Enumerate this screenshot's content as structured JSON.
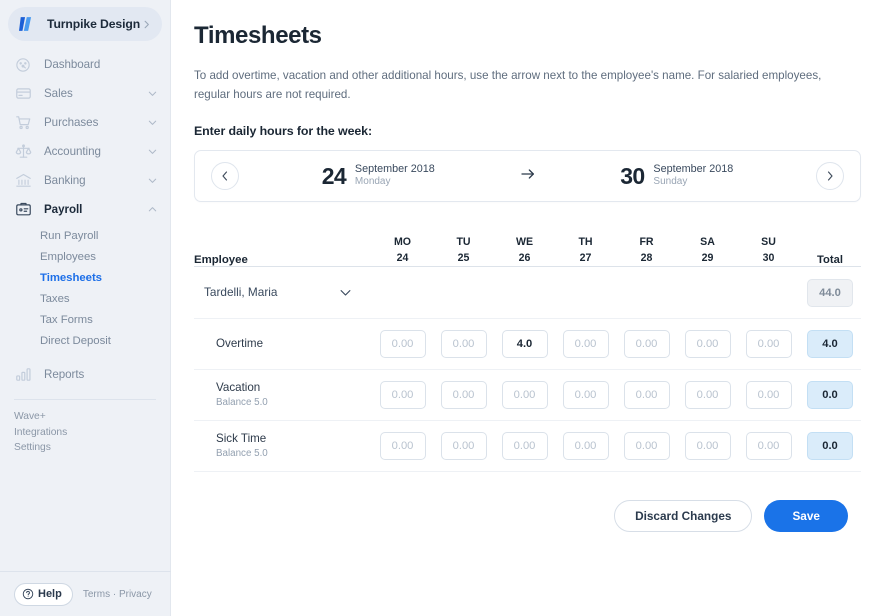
{
  "brand": {
    "name": "Turnpike Design",
    "logo_icon": "wave-logo-icon",
    "expand_icon": "chevron-right-icon"
  },
  "sidebar": {
    "items": [
      {
        "label": "Dashboard",
        "icon": "dashboard-gauge-icon",
        "caret": null,
        "active": false
      },
      {
        "label": "Sales",
        "icon": "credit-card-icon",
        "caret": "chevron-down-icon",
        "active": false
      },
      {
        "label": "Purchases",
        "icon": "shopping-cart-icon",
        "caret": "chevron-down-icon",
        "active": false
      },
      {
        "label": "Accounting",
        "icon": "scales-icon",
        "caret": "chevron-down-icon",
        "active": false
      },
      {
        "label": "Banking",
        "icon": "bank-icon",
        "caret": "chevron-down-icon",
        "active": false
      },
      {
        "label": "Payroll",
        "icon": "payroll-badge-icon",
        "caret": "chevron-up-icon",
        "active": true
      }
    ],
    "payroll_subitems": [
      {
        "label": "Run Payroll",
        "active": false
      },
      {
        "label": "Employees",
        "active": false
      },
      {
        "label": "Timesheets",
        "active": true
      },
      {
        "label": "Taxes",
        "active": false
      },
      {
        "label": "Tax Forms",
        "active": false
      },
      {
        "label": "Direct Deposit",
        "active": false
      }
    ],
    "reports": {
      "label": "Reports",
      "icon": "bar-chart-icon"
    },
    "mini_links": [
      "Wave+",
      "Integrations",
      "Settings"
    ],
    "footer": {
      "help_label": "Help",
      "help_icon": "question-circle-icon",
      "terms": "Terms · Privacy"
    },
    "accent_active": "#1d6fe8",
    "background": "#eef1f6"
  },
  "main": {
    "title": "Timesheets",
    "description": "To add overtime, vacation and other additional hours, use the arrow next to the employee's name. For salaried employees, regular hours are not required.",
    "section_title": "Enter daily hours for the week:",
    "week": {
      "prev_icon": "chevron-left-icon",
      "next_icon": "chevron-right-icon",
      "arrow_icon": "arrow-right-icon",
      "start": {
        "day": "24",
        "month": "September 2018",
        "weekday": "Monday"
      },
      "end": {
        "day": "30",
        "month": "September 2018",
        "weekday": "Sunday"
      }
    },
    "table": {
      "employee_header": "Employee",
      "total_header": "Total",
      "days": [
        {
          "dow": "MO",
          "date": "24"
        },
        {
          "dow": "TU",
          "date": "25"
        },
        {
          "dow": "WE",
          "date": "26"
        },
        {
          "dow": "TH",
          "date": "27"
        },
        {
          "dow": "FR",
          "date": "28"
        },
        {
          "dow": "SA",
          "date": "29"
        },
        {
          "dow": "SU",
          "date": "30"
        }
      ],
      "employee": {
        "name": "Tardelli, Maria",
        "collapse_icon": "chevron-down-icon",
        "total": "44.0"
      },
      "placeholder": "0.00",
      "rows": [
        {
          "label": "Overtime",
          "balance": "",
          "values": [
            "",
            "",
            "4.0",
            "",
            "",
            "",
            ""
          ],
          "total": "4.0"
        },
        {
          "label": "Vacation",
          "balance": "Balance 5.0",
          "values": [
            "",
            "",
            "",
            "",
            "",
            "",
            ""
          ],
          "total": "0.0"
        },
        {
          "label": "Sick Time",
          "balance": "Balance 5.0",
          "values": [
            "",
            "",
            "",
            "",
            "",
            "",
            ""
          ],
          "total": "0.0"
        }
      ]
    },
    "actions": {
      "discard_label": "Discard Changes",
      "save_label": "Save",
      "save_color": "#1a73e8"
    }
  }
}
